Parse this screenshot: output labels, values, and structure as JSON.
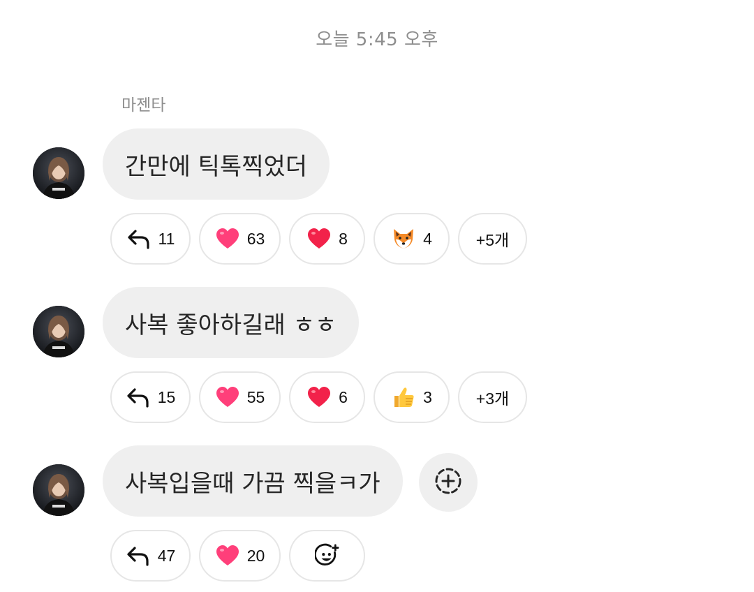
{
  "timestamp": "오늘 5:45 오후",
  "sender_name": "마젠타",
  "messages": [
    {
      "text": "간만에 틱톡찍었더",
      "reactions": {
        "reply": {
          "icon": "reply-icon",
          "count": "11"
        },
        "items": [
          {
            "icon": "heart-pink-icon",
            "count": "63"
          },
          {
            "icon": "heart-red-icon",
            "count": "8"
          },
          {
            "icon": "fox-face-icon",
            "count": "4"
          }
        ],
        "more": "+5개"
      }
    },
    {
      "text": "사복 좋아하길래 ㅎㅎ",
      "reactions": {
        "reply": {
          "icon": "reply-icon",
          "count": "15"
        },
        "items": [
          {
            "icon": "heart-pink-icon",
            "count": "55"
          },
          {
            "icon": "heart-red-icon",
            "count": "6"
          },
          {
            "icon": "thumbs-up-icon",
            "count": "3"
          }
        ],
        "more": "+3개"
      }
    },
    {
      "text": "사복입을때 가끔 찍을ㅋ가",
      "reactions": {
        "reply": {
          "icon": "reply-icon",
          "count": "47"
        },
        "items": [
          {
            "icon": "heart-pink-icon",
            "count": "20"
          }
        ],
        "add_reaction_icon": "add-emoji-icon"
      },
      "side_button_icon": "add-reaction-icon"
    }
  ],
  "colors": {
    "bubble": "#efefef",
    "meta_text": "#8e8e8e",
    "pill_border": "#e6e6e6",
    "heart_pink": "#ff3f7a",
    "heart_red": "#f2224a"
  }
}
